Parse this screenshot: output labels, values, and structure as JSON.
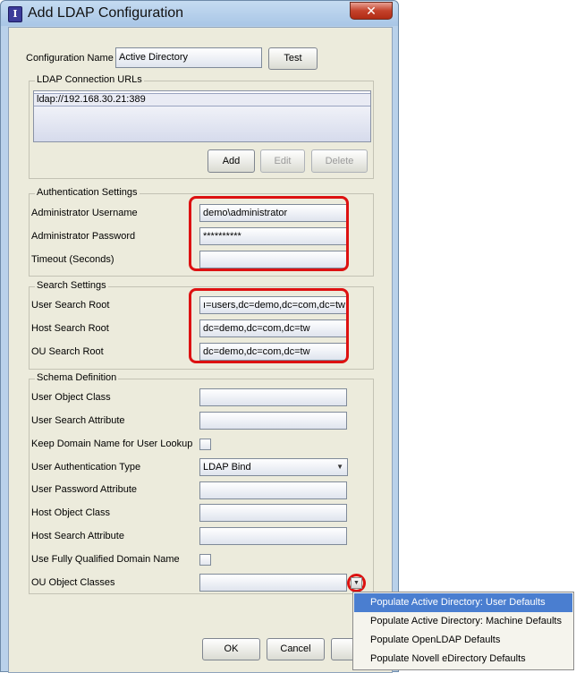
{
  "window": {
    "title": "Add LDAP Configuration",
    "close_label": "✕"
  },
  "config": {
    "name_label": "Configuration Name",
    "name_value": "Active Directory",
    "test_label": "Test"
  },
  "ldap_urls": {
    "group_title": "LDAP Connection URLs",
    "items": [
      "ldap://192.168.30.21:389"
    ],
    "add_label": "Add",
    "edit_label": "Edit",
    "delete_label": "Delete"
  },
  "auth": {
    "group_title": "Authentication Settings",
    "admin_user_label": "Administrator Username",
    "admin_user_value": "demo\\administrator",
    "admin_pass_label": "Administrator Password",
    "admin_pass_value": "**********",
    "timeout_label": "Timeout (Seconds)",
    "timeout_value": ""
  },
  "search": {
    "group_title": "Search Settings",
    "user_root_label": "User Search Root",
    "user_root_value": "ı=users,dc=demo,dc=com,dc=tw",
    "host_root_label": "Host Search Root",
    "host_root_value": "dc=demo,dc=com,dc=tw",
    "ou_root_label": "OU Search Root",
    "ou_root_value": "dc=demo,dc=com,dc=tw"
  },
  "schema": {
    "group_title": "Schema Definition",
    "user_object_class_label": "User Object Class",
    "user_search_attr_label": "User Search Attribute",
    "keep_domain_label": "Keep Domain Name for User Lookup",
    "user_auth_type_label": "User Authentication Type",
    "user_auth_type_value": "LDAP Bind",
    "user_pass_attr_label": "User Password Attribute",
    "host_object_class_label": "Host Object Class",
    "host_search_attr_label": "Host Search Attribute",
    "fqdn_label": "Use Fully Qualified Domain Name",
    "ou_object_classes_label": "OU Object Classes"
  },
  "footer": {
    "ok_label": "OK",
    "cancel_label": "Cancel"
  },
  "popup": {
    "items": [
      "Populate Active Directory: User Defaults",
      "Populate Active Directory: Machine Defaults",
      "Populate OpenLDAP Defaults",
      "Populate Novell eDirectory Defaults"
    ]
  },
  "colors": {
    "highlight": "#dd1111",
    "selection": "#4a7ed0"
  }
}
